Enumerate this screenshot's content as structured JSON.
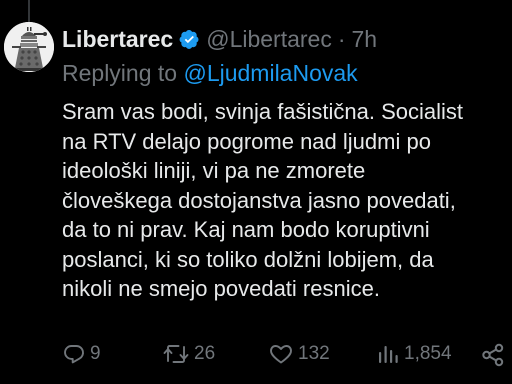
{
  "tweet": {
    "display_name": "Libertarec",
    "handle": "@Libertarec",
    "separator": "·",
    "time": "7h",
    "replying_to_prefix": "Replying to ",
    "replying_to_handle": "@LjudmilaNovak",
    "text_lines": [
      "Sram vas bodi, svinja fašistična. Socialist",
      "na RTV delajo pogrome nad ljudmi po",
      "ideološki liniji, vi pa ne zmorete",
      "človeškega dostojanstva jasno povedati,",
      "da to ni prav. Kaj nam bodo koruptivni",
      "poslanci, ki so toliko dolžni lobijem, da",
      "nikoli ne smejo povedati resnice."
    ]
  },
  "actions": {
    "replies": "9",
    "retweets": "26",
    "likes": "132",
    "views": "1,854"
  },
  "icons": {
    "avatar": "dalek-avatar",
    "verified": "verified-badge-icon",
    "reply": "reply-icon",
    "retweet": "retweet-icon",
    "like": "heart-icon",
    "views": "views-icon",
    "share": "share-icon"
  },
  "colors": {
    "background": "#000000",
    "text": "#e7e9ea",
    "muted": "#71767b",
    "accent": "#1d9bf0"
  }
}
